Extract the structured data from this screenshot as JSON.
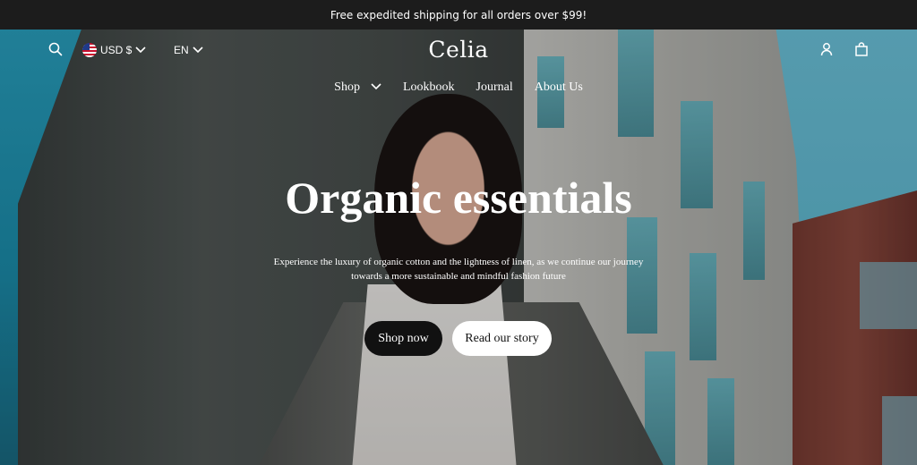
{
  "announcement": {
    "text": "Free expedited shipping for all orders over $99!"
  },
  "header": {
    "currency_label": "USD $",
    "language_label": "EN",
    "logo": "Celia",
    "icons": {
      "search": "search-icon",
      "account": "account-icon",
      "cart": "cart-icon",
      "flag": "us-flag-icon",
      "chevron": "chevron-down-icon"
    }
  },
  "nav": {
    "items": [
      {
        "label": "Shop",
        "has_dropdown": true
      },
      {
        "label": "Lookbook"
      },
      {
        "label": "Journal"
      },
      {
        "label": "About Us"
      }
    ]
  },
  "hero": {
    "headline": "Organic essentials",
    "subtext_line1": "Experience the luxury of organic cotton and the lightness of linen, as we continue our journey",
    "subtext_line2": "towards a more sustainable and mindful fashion future",
    "primary_button": "Shop now",
    "secondary_button": "Read our story"
  },
  "colors": {
    "announcement_bg": "#1c1c1c",
    "primary_button_bg": "#111111",
    "secondary_button_bg": "#ffffff",
    "text_on_hero": "#ffffff"
  }
}
